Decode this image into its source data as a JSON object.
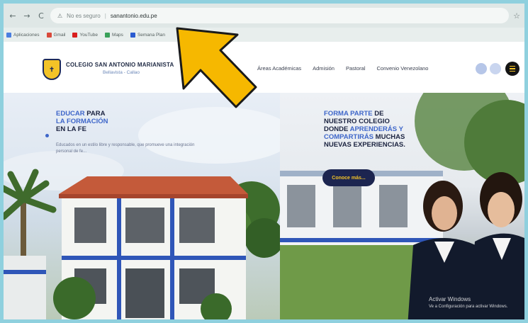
{
  "browser": {
    "back": "←",
    "forward": "→",
    "reload": "C",
    "secure_label": "No es seguro",
    "url": "sanantonio.edu.pe",
    "star": "☆"
  },
  "bookmarks": [
    {
      "label": "Aplicaciones",
      "color": "#4b7fe0"
    },
    {
      "label": "Gmail",
      "color": "#d94a3c"
    },
    {
      "label": "YouTube",
      "color": "#d91e1e"
    },
    {
      "label": "Maps",
      "color": "#3aa15a"
    },
    {
      "label": "Semana Plan",
      "color": "#2a5bd0"
    }
  ],
  "header": {
    "school_name": "COLEGIO SAN ANTONIO MARIANISTA",
    "school_sub": "Bellavista - Callao",
    "menu": [
      "Áreas Académicas",
      "Admisión",
      "Pastoral",
      "Convenio Venezolano"
    ]
  },
  "hero_left": {
    "title_line1_blue": "EDUCAR",
    "title_line1_dark": " PARA",
    "title_line2_blue": "LA FORMACIÓN",
    "title_line3_dark": "EN LA FE",
    "description": "Educados en un estilo libre y responsable, que promueve una integración personal de fe..."
  },
  "hero_right": {
    "title_line1_blue": "FORMA PARTE",
    "title_line1_dark": " DE",
    "title_line2_dark": "NUESTRO COLEGIO",
    "title_line3_dark": "DONDE ",
    "title_line3_blue": "APRENDERÁS Y",
    "title_line4_blue": "COMPARTIRÁS",
    "title_line4_dark": " MUCHAS",
    "title_line5_dark": "NUEVAS EXPERIENCIAS.",
    "cta_label": "Conoce más..."
  },
  "watermark": {
    "line1": "Activar Windows",
    "line2": "Ve a Configuración para activar Windows."
  },
  "colors": {
    "accent_blue": "#3e66c9",
    "navy": "#1c2550",
    "gold": "#f3c327",
    "arrow": "#f6b800"
  }
}
